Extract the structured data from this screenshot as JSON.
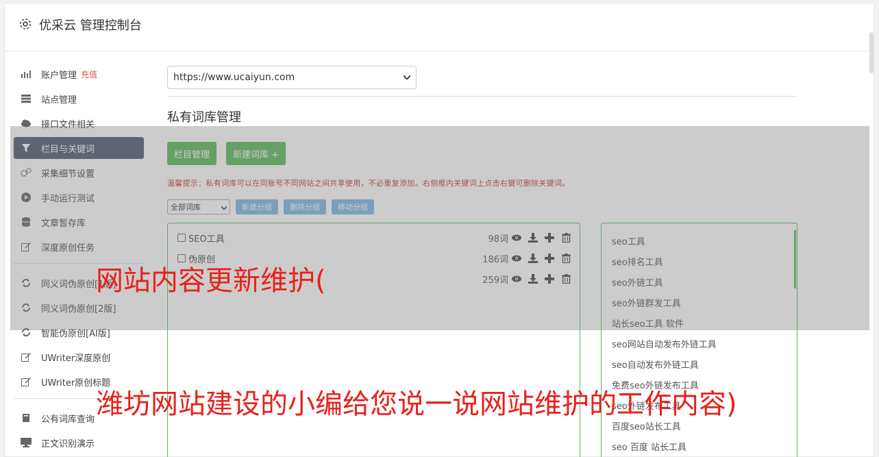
{
  "header": {
    "title": "优采云 管理控制台"
  },
  "sidebar": {
    "items": [
      {
        "label": "账户管理",
        "badge": "充值",
        "icon": "bar-chart-icon"
      },
      {
        "label": "站点管理",
        "icon": "server-icon"
      },
      {
        "label": "接口文件相关",
        "icon": "cloud-upload-icon"
      },
      {
        "label": "栏目与关键词",
        "icon": "filter-icon",
        "active": true
      },
      {
        "label": "采集细节设置",
        "icon": "gears-icon"
      },
      {
        "label": "手动运行测试",
        "icon": "play-circle-icon"
      },
      {
        "label": "文章暂存库",
        "icon": "database-icon"
      },
      {
        "label": "深度原创任务",
        "icon": "edit-icon"
      }
    ],
    "items2": [
      {
        "label": "同义词伪原创[1版]",
        "icon": "refresh-icon"
      },
      {
        "label": "同义词伪原创[2版]",
        "icon": "refresh-icon"
      },
      {
        "label": "智能伪原创[AI版]",
        "icon": "refresh-icon"
      },
      {
        "label": "UWriter深度原创",
        "icon": "edit-icon"
      },
      {
        "label": "UWriter原创标题",
        "icon": "edit-icon"
      }
    ],
    "items3": [
      {
        "label": "公有词库查询",
        "icon": "book-icon"
      },
      {
        "label": "正文识别演示",
        "icon": "monitor-icon"
      }
    ]
  },
  "main": {
    "site_select": "https://www.ucaiyun.com",
    "section_title": "私有词库管理",
    "btn_columns": "栏目管理",
    "btn_new_lib": "新建词库 +",
    "tip": "温馨提示：私有词库可以在同账号不同网站之间共享使用，不必重复添加。右侧框内关键词上点击右键可删除关键词。",
    "lib_filter": "全部词库",
    "btn_new_group": "新建分组",
    "btn_delete_group": "删除分组",
    "btn_move_group": "移动分组",
    "libraries": [
      {
        "name": "SEO工具",
        "count": "98词"
      },
      {
        "name": "伪原创",
        "count": "186词"
      },
      {
        "name": "",
        "count": "259词"
      }
    ],
    "keywords": [
      "seo工具",
      "seo排名工具",
      "seo外链工具",
      "seo外链群发工具",
      "站长seo工具 软件",
      "seo网站自动发布外链工具",
      "seo自动发布外链工具",
      "免费seo外链发布工具",
      "seo外链发布工具",
      "百度seo站长工具",
      "seo 百度 站长工具"
    ]
  },
  "watermark": {
    "line1": "网站内容更新维护(",
    "line2": "潍坊网站建设的小编给您说一说网站维护的工作内容)"
  },
  "colors": {
    "active_nav": "#4e5a6e",
    "green": "#5cb85c",
    "blue": "#7cb5e6",
    "watermark": "#e8211a",
    "tip": "#c0392b"
  }
}
